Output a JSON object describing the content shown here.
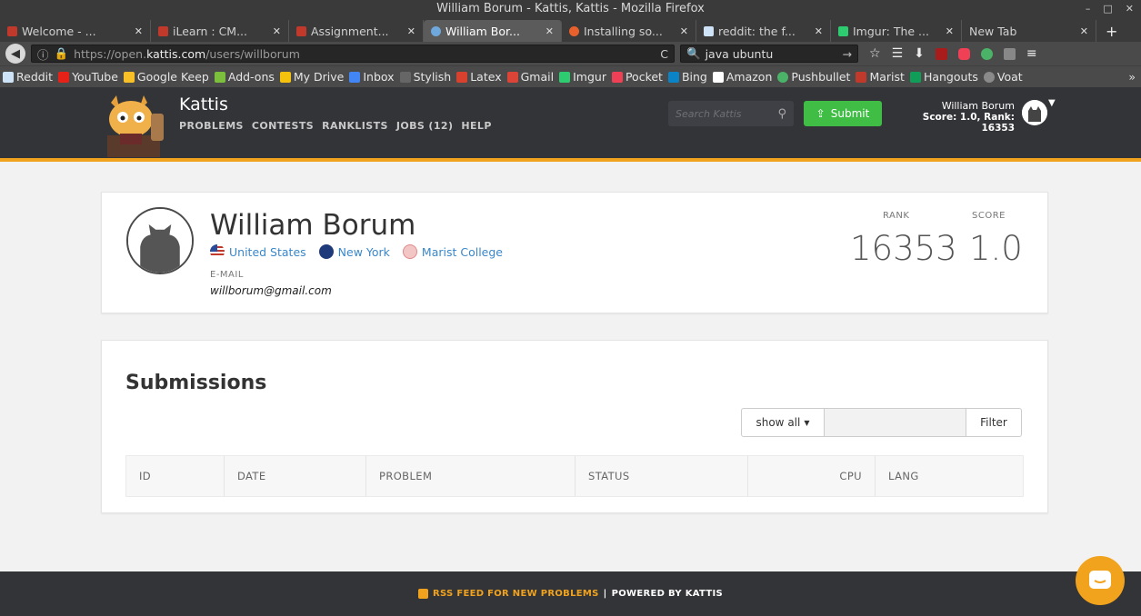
{
  "window": {
    "title": "William Borum - Kattis, Kattis - Mozilla Firefox",
    "controls": [
      "–",
      "□",
      "✕"
    ]
  },
  "tabs": [
    {
      "label": "Welcome - ...",
      "close": "✕",
      "color": "#c0392b",
      "active": false
    },
    {
      "label": "iLearn : CM...",
      "close": "✕",
      "color": "#c0392b",
      "active": false
    },
    {
      "label": "Assignment...",
      "close": "✕",
      "color": "#c0392b",
      "active": false
    },
    {
      "label": "William Bor...",
      "close": "✕",
      "color": "#6fa8dc",
      "active": true
    },
    {
      "label": "Installing so...",
      "close": "✕",
      "color": "#e8612c",
      "active": false
    },
    {
      "label": "reddit: the f...",
      "close": "✕",
      "color": "#cee3f8",
      "active": false
    },
    {
      "label": "Imgur: The ...",
      "close": "✕",
      "color": "#2ecc71",
      "active": false
    },
    {
      "label": "New Tab",
      "close": "✕",
      "color": "",
      "active": false
    }
  ],
  "new_tab": "+",
  "nav": {
    "url_prefix": "https://open.",
    "url_host": "kattis.com",
    "url_path": "/users/willborum",
    "reload": "C",
    "search_value": "java ubuntu",
    "search_go": "→"
  },
  "toolbar_icons": [
    "star-icon",
    "reading-list-icon",
    "download-icon",
    "ublock-icon",
    "pocket-icon",
    "pushbullet-icon",
    "stylish-icon",
    "menu-icon"
  ],
  "bookmarks": [
    {
      "label": "Reddit",
      "color": "#cee3f8"
    },
    {
      "label": "YouTube",
      "color": "#e62117"
    },
    {
      "label": "Google Keep",
      "color": "#f6c026"
    },
    {
      "label": "Add-ons",
      "color": "#7bbf3d"
    },
    {
      "label": "My Drive",
      "color": "#f4c20d"
    },
    {
      "label": "Inbox",
      "color": "#4285f4"
    },
    {
      "label": "Stylish",
      "color": "#666666"
    },
    {
      "label": "Latex",
      "color": "#d9412f"
    },
    {
      "label": "Gmail",
      "color": "#db4437"
    },
    {
      "label": "Imgur",
      "color": "#2ecc71"
    },
    {
      "label": "Pocket",
      "color": "#ef4056"
    },
    {
      "label": "Bing",
      "color": "#0a84c6"
    },
    {
      "label": "Amazon",
      "color": "#222222"
    },
    {
      "label": "Pushbullet",
      "color": "#4ab367"
    },
    {
      "label": "Marist",
      "color": "#c0392b"
    },
    {
      "label": "Hangouts",
      "color": "#0f9d58"
    },
    {
      "label": "Voat",
      "color": "#8a8a8a"
    }
  ],
  "bookmarks_more": "»",
  "site": {
    "brand": "Kattis",
    "menu": [
      "PROBLEMS",
      "CONTESTS",
      "RANKLISTS",
      "JOBS (12)",
      "HELP"
    ],
    "search_placeholder": "Search Kattis",
    "submit_label": "Submit",
    "user_name": "William Borum",
    "user_score": "Score: 1.0, Rank: 16353"
  },
  "profile": {
    "name": "William Borum",
    "country": "United States",
    "state": "New York",
    "school": "Marist College",
    "email_label": "E-MAIL",
    "email": "willborum@gmail.com",
    "rank_label": "RANK",
    "rank": "16353",
    "score_label": "SCORE",
    "score": "1.0"
  },
  "submissions": {
    "title": "Submissions",
    "show_all": "show all",
    "filter_value": "",
    "filter_button": "Filter",
    "columns": [
      "ID",
      "DATE",
      "PROBLEM",
      "STATUS",
      "CPU",
      "LANG"
    ]
  },
  "footer": {
    "rss": "RSS FEED FOR NEW PROBLEMS",
    "separator": "|",
    "powered": "POWERED BY KATTIS"
  },
  "colors": {
    "accent": "#f2a31d",
    "submit": "#3fbd45",
    "link": "#3a87c8",
    "header_bg": "#333438"
  }
}
